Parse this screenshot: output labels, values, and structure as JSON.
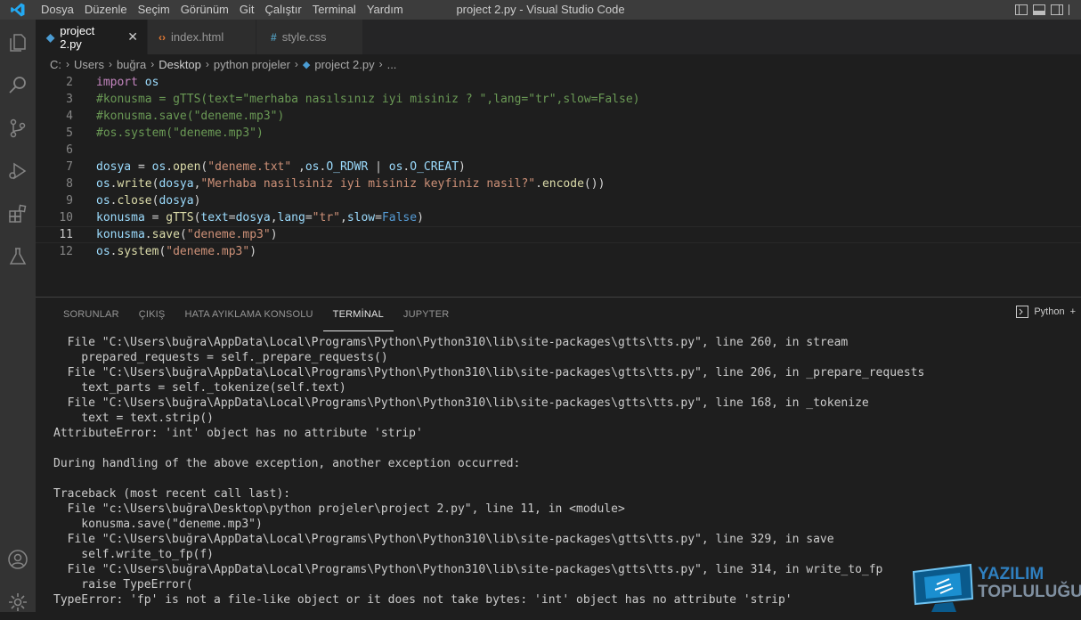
{
  "titlebar": {
    "menu": [
      "Dosya",
      "Düzenle",
      "Seçim",
      "Görünüm",
      "Git",
      "Çalıştır",
      "Terminal",
      "Yardım"
    ],
    "title": "project 2.py - Visual Studio Code"
  },
  "tabs": [
    {
      "label": "project 2.py",
      "icon": "python-icon",
      "active": true
    },
    {
      "label": "index.html",
      "icon": "html-icon",
      "active": false
    },
    {
      "label": "style.css",
      "icon": "css-icon",
      "active": false
    }
  ],
  "breadcrumb": [
    "C:",
    "Users",
    "buğra",
    "Desktop",
    "python projeler",
    "project 2.py",
    "..."
  ],
  "editor": {
    "lines": [
      {
        "n": "2",
        "text": "import os"
      },
      {
        "n": "3",
        "text": "#konusma = gTTS(text=\"merhaba nasılsınız iyi misiniz ? \",lang=\"tr\",slow=False)"
      },
      {
        "n": "4",
        "text": "#konusma.save(\"deneme.mp3\")"
      },
      {
        "n": "5",
        "text": "#os.system(\"deneme.mp3\")"
      },
      {
        "n": "6",
        "text": ""
      },
      {
        "n": "7",
        "text": "dosya = os.open(\"deneme.txt\" ,os.O_RDWR | os.O_CREAT)"
      },
      {
        "n": "8",
        "text": "os.write(dosya,\"Merhaba nasilsiniz iyi misiniz keyfiniz nasil?\".encode())"
      },
      {
        "n": "9",
        "text": "os.close(dosya)"
      },
      {
        "n": "10",
        "text": "konusma = gTTS(text=dosya,lang=\"tr\",slow=False)"
      },
      {
        "n": "11",
        "text": "konusma.save(\"deneme.mp3\")"
      },
      {
        "n": "12",
        "text": "os.system(\"deneme.mp3\")"
      }
    ]
  },
  "panel": {
    "tabs": [
      "SORUNLAR",
      "ÇIKIŞ",
      "HATA AYIKLAMA KONSOLU",
      "TERMİNAL",
      "JUPYTER"
    ],
    "active_tab": "TERMİNAL",
    "terminal_name": "Python",
    "terminal_lines": [
      "  File \"C:\\Users\\buğra\\AppData\\Local\\Programs\\Python\\Python310\\lib\\site-packages\\gtts\\tts.py\", line 260, in stream",
      "    prepared_requests = self._prepare_requests()",
      "  File \"C:\\Users\\buğra\\AppData\\Local\\Programs\\Python\\Python310\\lib\\site-packages\\gtts\\tts.py\", line 206, in _prepare_requests",
      "    text_parts = self._tokenize(self.text)",
      "  File \"C:\\Users\\buğra\\AppData\\Local\\Programs\\Python\\Python310\\lib\\site-packages\\gtts\\tts.py\", line 168, in _tokenize",
      "    text = text.strip()",
      "AttributeError: 'int' object has no attribute 'strip'",
      "",
      "During handling of the above exception, another exception occurred:",
      "",
      "Traceback (most recent call last):",
      "  File \"c:\\Users\\buğra\\Desktop\\python projeler\\project 2.py\", line 11, in <module>",
      "    konusma.save(\"deneme.mp3\")",
      "  File \"C:\\Users\\buğra\\AppData\\Local\\Programs\\Python\\Python310\\lib\\site-packages\\gtts\\tts.py\", line 329, in save",
      "    self.write_to_fp(f)",
      "  File \"C:\\Users\\buğra\\AppData\\Local\\Programs\\Python\\Python310\\lib\\site-packages\\gtts\\tts.py\", line 314, in write_to_fp",
      "    raise TypeError(",
      "TypeError: 'fp' is not a file-like object or it does not take bytes: 'int' object has no attribute 'strip'"
    ]
  },
  "watermark": {
    "line1": "YAZILIM",
    "line2": "TOPLULUĞU"
  },
  "colors": {
    "accent": "#007acc",
    "activitybar": "#333333",
    "editor_bg": "#1e1e1e"
  }
}
